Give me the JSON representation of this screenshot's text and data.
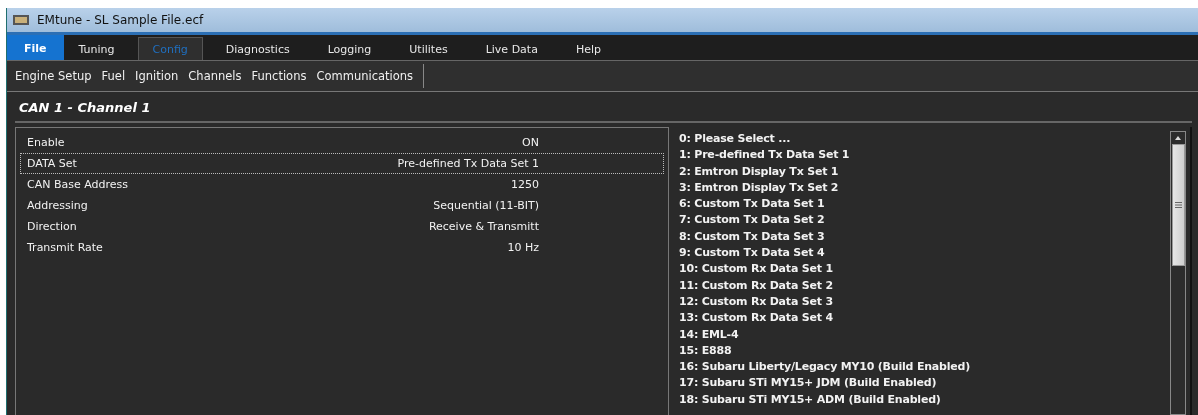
{
  "window": {
    "title": "EMtune - SL Sample File.ecf"
  },
  "menu_tabs": [
    {
      "label": "File",
      "kind": "app",
      "selected": false
    },
    {
      "label": "Tuning",
      "kind": "tab",
      "selected": false
    },
    {
      "label": "Config",
      "kind": "tab",
      "selected": true
    },
    {
      "label": "Diagnostics",
      "kind": "tab",
      "selected": false
    },
    {
      "label": "Logging",
      "kind": "tab",
      "selected": false
    },
    {
      "label": "Utilites",
      "kind": "tab",
      "selected": false
    },
    {
      "label": "Live Data",
      "kind": "tab",
      "selected": false
    },
    {
      "label": "Help",
      "kind": "tab",
      "selected": false
    }
  ],
  "submenu": [
    "Engine Setup",
    "Fuel",
    "Ignition",
    "Channels",
    "Functions",
    "Communications"
  ],
  "heading": "CAN 1 - Channel 1",
  "properties": [
    {
      "name": "Enable",
      "value": "ON",
      "selected": false
    },
    {
      "name": "DATA Set",
      "value": "Pre-defined Tx Data Set 1",
      "selected": true
    },
    {
      "name": "CAN Base Address",
      "value": "1250",
      "selected": false
    },
    {
      "name": "Addressing",
      "value": "Sequential (11-BIT)",
      "selected": false
    },
    {
      "name": "Direction",
      "value": "Receive & Transmitt",
      "selected": false
    },
    {
      "name": "Transmit Rate",
      "value": "10 Hz",
      "selected": false
    }
  ],
  "options": [
    "0: Please Select ...",
    "1: Pre-defined Tx Data Set 1",
    "2: Emtron Display Tx Set 1",
    "3: Emtron Display Tx Set 2",
    "6: Custom Tx Data Set 1",
    "7: Custom Tx Data Set 2",
    "8: Custom Tx Data Set 3",
    "9: Custom Tx Data Set 4",
    "10: Custom Rx Data Set 1",
    "11: Custom Rx Data Set 2",
    "12: Custom Rx Data Set 3",
    "13: Custom Rx Data Set 4",
    "14: EML-4",
    "15: E888",
    "16: Subaru Liberty/Legacy MY10 (Build Enabled)",
    "17: Subaru STi MY15+ JDM (Build Enabled)",
    "18: Subaru STi MY15+ ADM (Build Enabled)"
  ]
}
